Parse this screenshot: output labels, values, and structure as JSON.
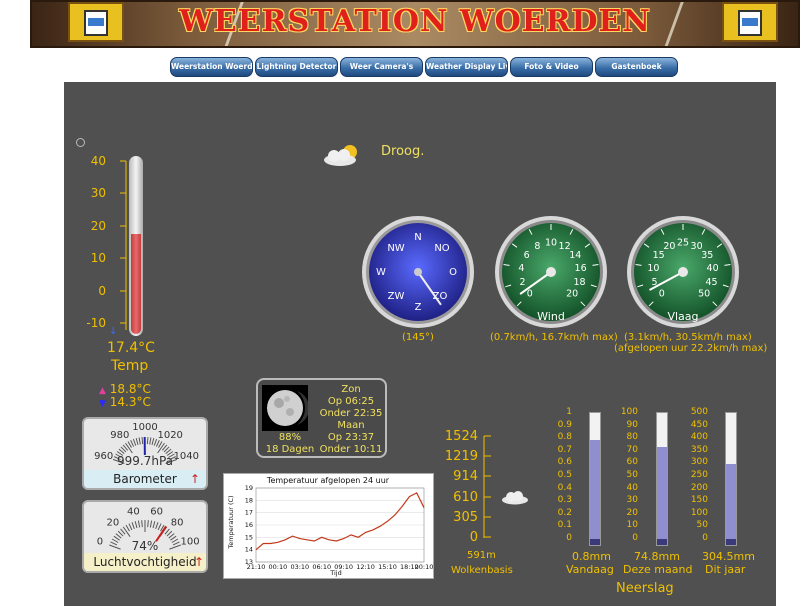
{
  "header": {
    "title": "WEERSTATION WOERDEN"
  },
  "nav": {
    "items": [
      "Weerstation Woerden",
      "Lightning Detector",
      "Weer Camera's",
      "Weather Display Live",
      "Foto & Video",
      "Gastenboek"
    ]
  },
  "condition": {
    "text": "Droog.",
    "icon": "partly-cloudy-icon"
  },
  "thermometer": {
    "scale": [
      "40",
      "30",
      "20",
      "10",
      "0",
      "-10"
    ],
    "value": "17.4°C",
    "label": "Temp",
    "max": "18.8°C",
    "min": "14.3°C",
    "level_celsius": 17.4
  },
  "compass": {
    "labels": {
      "n": "N",
      "no": "NO",
      "o": "O",
      "zo": "ZO",
      "z": "Z",
      "zw": "ZW",
      "w": "W",
      "nw": "NW"
    },
    "direction_text": "(145°)",
    "direction_deg": 145
  },
  "wind_gauge": {
    "ticks": [
      "0",
      "2",
      "4",
      "6",
      "8",
      "10",
      "12",
      "14",
      "16",
      "18",
      "20"
    ],
    "label": "Wind",
    "text": "(0.7km/h, 16.7km/h max)",
    "value_kmh": 0.7
  },
  "gust_gauge": {
    "ticks": [
      "0",
      "5",
      "10",
      "15",
      "20",
      "25",
      "30",
      "35",
      "40",
      "45",
      "50"
    ],
    "label": "Vlaag",
    "text1": "(3.1km/h, 30.5km/h max)",
    "text2": "(afgelopen uur 22.2km/h max)",
    "value_kmh": 3.1
  },
  "astro": {
    "zon_label": "Zon",
    "sunrise": "Op 06:25",
    "sunset": "Onder 22:35",
    "maan_label": "Maan",
    "moon_pct": "88%",
    "moon_age": "18 Dagen",
    "moonrise": "Op 23:37",
    "moonset": "Onder 10:11"
  },
  "barometer": {
    "ticks": [
      "960",
      "980",
      "1000",
      "1020",
      "1040"
    ],
    "value": "999.7hPa",
    "label": "Barometer",
    "trend": "↑",
    "value_hpa": 999.7
  },
  "humidity": {
    "ticks": [
      "0",
      "20",
      "40",
      "60",
      "80",
      "100"
    ],
    "value": "74%",
    "label": "Luchtvochtigheid",
    "trend": "↑",
    "value_pct": 74
  },
  "temp_chart": {
    "title": "Temperatuur afgelopen 24 uur",
    "ylabel": "Temperatuur (C)",
    "xlabel": "Tijd",
    "yticks": [
      "19",
      "18",
      "17",
      "16",
      "15",
      "14",
      "13"
    ],
    "xticks": [
      "21:10",
      "00:10",
      "03:10",
      "06:10",
      "09:10",
      "12:10",
      "15:10",
      "18:10",
      "20:10"
    ]
  },
  "cloudbase": {
    "ticks": [
      "1524",
      "1219",
      "914",
      "610",
      "305",
      "0"
    ],
    "value": "591m",
    "label": "Wolkenbasis",
    "value_m": 591
  },
  "rain": {
    "title": "Neerslag",
    "today": {
      "ticks": [
        "1",
        "0.9",
        "0.8",
        "0.7",
        "0.6",
        "0.5",
        "0.4",
        "0.3",
        "0.2",
        "0.1",
        "0"
      ],
      "value": "0.8mm",
      "label": "Vandaag",
      "fraction": 0.8
    },
    "month": {
      "ticks": [
        "100",
        "90",
        "80",
        "70",
        "60",
        "50",
        "40",
        "30",
        "20",
        "10",
        "0"
      ],
      "value": "74.8mm",
      "label": "Deze maand",
      "fraction": 0.748
    },
    "year": {
      "ticks": [
        "500",
        "450",
        "400",
        "350",
        "300",
        "250",
        "200",
        "150",
        "100",
        "50",
        "0"
      ],
      "value": "304.5mm",
      "label": "Dit jaar",
      "fraction": 0.609
    }
  },
  "chart_data": {
    "type": "line",
    "title": "Temperatuur afgelopen 24 uur",
    "xlabel": "Tijd",
    "ylabel": "Temperatuur (C)",
    "ylim": [
      13,
      19
    ],
    "x": [
      "21:10",
      "22:10",
      "23:10",
      "00:10",
      "01:10",
      "02:10",
      "03:10",
      "04:10",
      "05:10",
      "06:10",
      "07:10",
      "08:10",
      "09:10",
      "10:10",
      "11:10",
      "12:10",
      "13:10",
      "14:10",
      "15:10",
      "16:10",
      "17:10",
      "18:10",
      "19:10",
      "20:10"
    ],
    "xticks": [
      "21:10",
      "00:10",
      "03:10",
      "06:10",
      "09:10",
      "12:10",
      "15:10",
      "18:10",
      "20:10"
    ],
    "series": [
      {
        "values": [
          14.0,
          14.5,
          14.5,
          14.6,
          14.8,
          15.1,
          14.9,
          14.8,
          14.7,
          15.0,
          14.8,
          14.7,
          14.9,
          15.2,
          15.0,
          15.4,
          15.6,
          15.9,
          16.3,
          16.8,
          17.5,
          18.3,
          18.6,
          17.4
        ]
      }
    ]
  }
}
